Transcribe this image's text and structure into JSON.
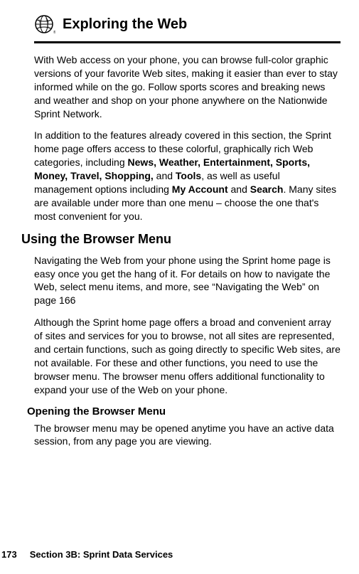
{
  "header": {
    "title": "Exploring the Web",
    "icon": "globe-icon"
  },
  "body": {
    "p1_a": "With Web access on your phone, you can browse full-color graphic versions of your favorite Web sites, making it easier than ever to stay informed while on the go. Follow sports scores and breaking news and weather and shop on your phone anywhere on the Nationwide Sprint Network.",
    "p2_a": "In addition to the features already covered in this section, the Sprint home page offers access to these colorful, graphically rich Web categories, including ",
    "p2_bold1": "News, Weather, Entertainment, Sports, Money, Travel, Shopping,",
    "p2_b": " and ",
    "p2_bold2": "Tools",
    "p2_c": ", as well as useful management options including ",
    "p2_bold3": "My Account",
    "p2_d": " and ",
    "p2_bold4": "Search",
    "p2_e": ". Many sites are available under more than one menu – choose the one that's most convenient for you."
  },
  "section1": {
    "heading": "Using the Browser Menu",
    "p1": "Navigating the Web from your phone using the Sprint home page is easy once you get the hang of it. For details on how to navigate the Web, select menu items, and more, see “Navigating the Web” on page 166",
    "p2": "Although the Sprint home page offers a broad and convenient array of sites and services for you to browse, not all sites are represented, and certain functions, such as going directly to specific Web sites, are not available. For these and other functions, you need to use the browser menu. The browser menu offers additional functionality to expand your use of the Web on your phone."
  },
  "section2": {
    "heading": "Opening the Browser Menu",
    "p1": "The browser menu may be opened anytime you have an active data session, from any page you are viewing."
  },
  "footer": {
    "page_number": "173",
    "section_label": "Section 3B: Sprint Data Services"
  }
}
